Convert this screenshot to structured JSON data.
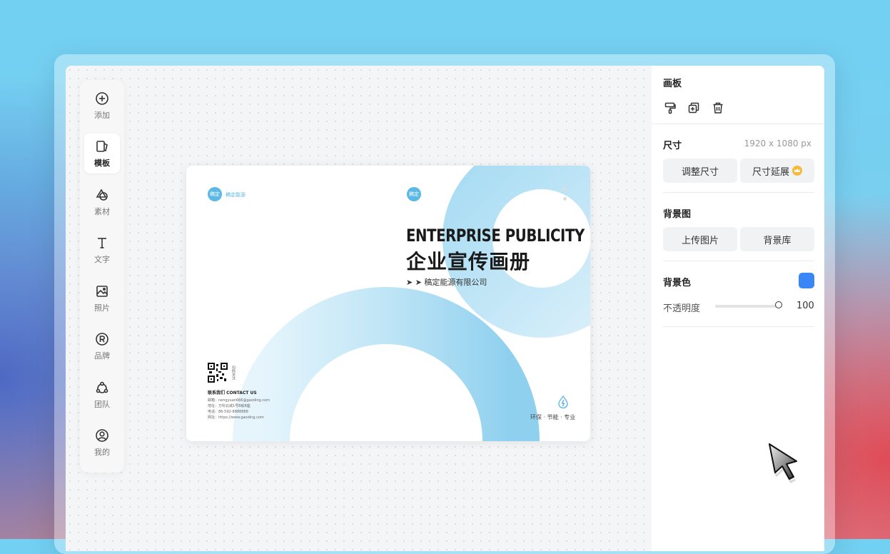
{
  "toolbar": {
    "items": [
      {
        "label": "添加",
        "icon": "plus-circle-icon"
      },
      {
        "label": "模板",
        "icon": "template-icon",
        "active": true
      },
      {
        "label": "素材",
        "icon": "shapes-icon"
      },
      {
        "label": "文字",
        "icon": "text-t-icon"
      },
      {
        "label": "照片",
        "icon": "image-icon"
      },
      {
        "label": "品牌",
        "icon": "registered-icon"
      },
      {
        "label": "团队",
        "icon": "team-icon"
      },
      {
        "label": "我的",
        "icon": "user-icon"
      }
    ]
  },
  "poster": {
    "logo_text": "稿定",
    "brand_text": "稿定能源",
    "title_en": "ENTERPRISE PUBLICITY",
    "title_cn": "企业宣传画册",
    "company": "➤ ➤  稿定能源有限公司",
    "qr_note": "扫码关注",
    "contact_title": "联系我们 CONTACT US",
    "contact_lines": [
      "邮箱：nengyuan666@gaoding.com",
      "地址：万科云城1号8栋B座",
      "电话：86-592-8888888",
      "网址：https://www.gaoding.com"
    ],
    "slogan": "环保 · 节能 · 专业",
    "accent_color": "#5cb8e4"
  },
  "panel": {
    "board_title": "画板",
    "board_icons": [
      "format-brush-icon",
      "duplicate-icon",
      "trash-icon"
    ],
    "size_title": "尺寸",
    "size_value": "1920 x 1080 px",
    "resize_label": "调整尺寸",
    "extend_label": "尺寸延展",
    "bgimage_title": "背景图",
    "upload_label": "上传图片",
    "library_label": "背景库",
    "bgcolor_title": "背景色",
    "bgcolor_value": "#3a86f7",
    "opacity_label": "不透明度",
    "opacity_value": "100"
  }
}
